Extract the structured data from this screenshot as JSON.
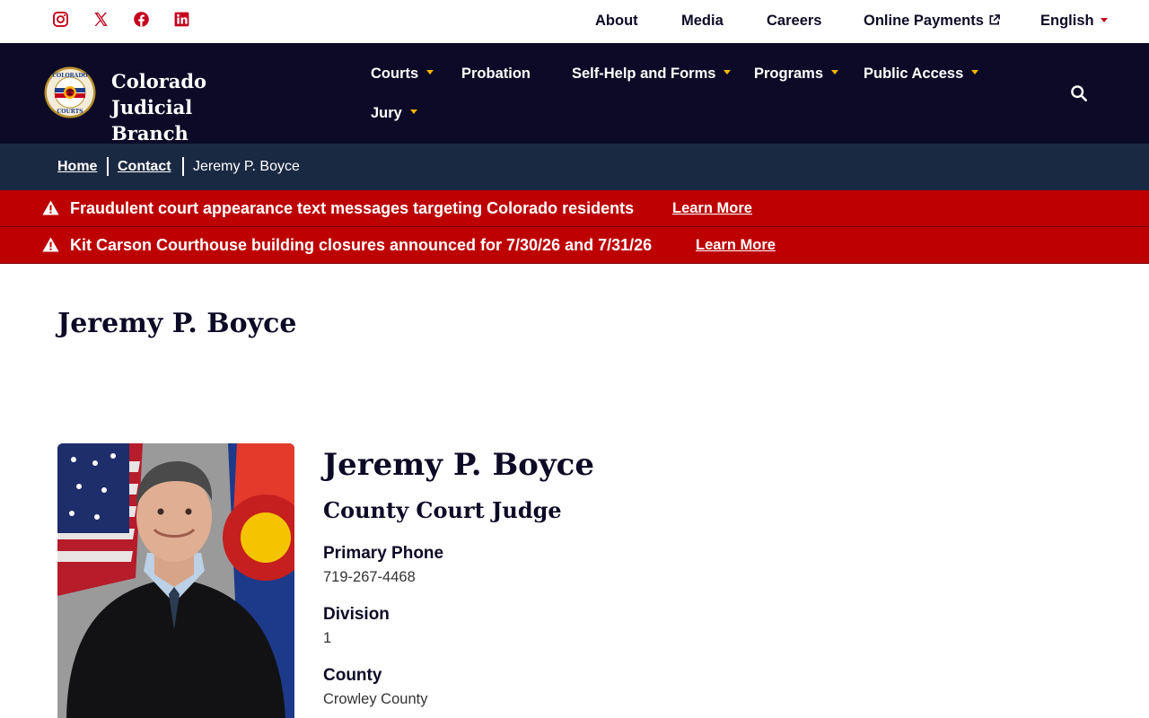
{
  "colors": {
    "navy": "#0c0a26",
    "breadcrumb_bg": "#1a2942",
    "alert_red": "#bd0000",
    "accent_red": "#c4001d",
    "gold": "#f5b400"
  },
  "social": [
    {
      "icon": "instagram-icon"
    },
    {
      "icon": "x-icon"
    },
    {
      "icon": "facebook-icon"
    },
    {
      "icon": "linkedin-icon"
    }
  ],
  "utility": {
    "about": "About",
    "media": "Media",
    "careers": "Careers",
    "payments": "Online Payments",
    "language": "English"
  },
  "brand": {
    "line1": "Colorado Judicial",
    "line2": "Branch"
  },
  "nav": {
    "courts": "Courts",
    "probation": "Probation",
    "self_help": "Self-Help and Forms",
    "programs": "Programs",
    "public_access": "Public Access",
    "jury": "Jury"
  },
  "breadcrumb": {
    "home": "Home",
    "contact": "Contact",
    "current": "Jeremy P. Boyce"
  },
  "alerts": [
    {
      "message": "Fraudulent court appearance text messages targeting Colorado residents",
      "link": "Learn More"
    },
    {
      "message": "Kit Carson Courthouse building closures announced for 7/30/26 and 7/31/26",
      "link": "Learn More"
    }
  ],
  "page": {
    "title": "Jeremy P. Boyce"
  },
  "profile": {
    "name": "Jeremy P. Boyce",
    "role": "County Court Judge",
    "phone_label": "Primary Phone",
    "phone": "719-267-4468",
    "division_label": "Division",
    "division": "1",
    "county_label": "County",
    "county": "Crowley County"
  }
}
